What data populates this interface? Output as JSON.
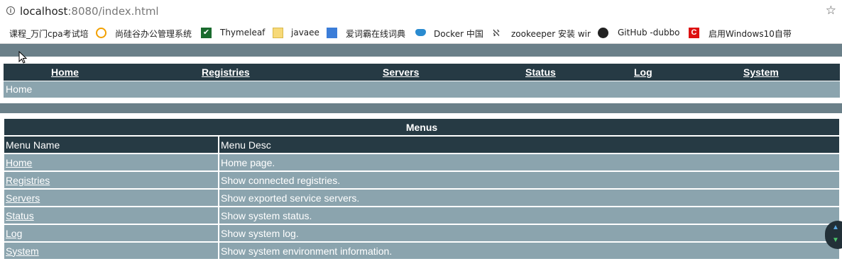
{
  "browser": {
    "url_host": "localhost",
    "url_rest": ":8080/index.html",
    "bookmarks": [
      {
        "label": "课程_万门cpa考试培",
        "icon": "doc-icon"
      },
      {
        "label": "尚硅谷办公管理系统",
        "icon": "u-logo-icon"
      },
      {
        "label": "Thymeleaf",
        "icon": "check-icon"
      },
      {
        "label": "javaee",
        "icon": "folder-icon"
      },
      {
        "label": "爱词霸在线词典",
        "icon": "dictionary-icon"
      },
      {
        "label": "Docker 中国",
        "icon": "docker-icon"
      },
      {
        "label": "zookeeper 安装 wir",
        "icon": "zk-icon"
      },
      {
        "label": "GitHub -dubbo",
        "icon": "github-icon"
      },
      {
        "label": "启用Windows10自带",
        "icon": "c-logo-icon"
      }
    ]
  },
  "nav": {
    "items": [
      "Home",
      "Registries",
      "Servers",
      "Status",
      "Log",
      "System"
    ],
    "breadcrumb": "Home"
  },
  "menus": {
    "title": "Menus",
    "col_name": "Menu Name",
    "col_desc": "Menu Desc",
    "rows": [
      {
        "name": "Home",
        "desc": "Home page."
      },
      {
        "name": "Registries",
        "desc": "Show connected registries."
      },
      {
        "name": "Servers",
        "desc": "Show exported service servers."
      },
      {
        "name": "Status",
        "desc": "Show system status."
      },
      {
        "name": "Log",
        "desc": "Show system log."
      },
      {
        "name": "System",
        "desc": "Show system environment information."
      }
    ]
  },
  "colors": {
    "dark": "#263a44",
    "light": "#8ba4ae",
    "band": "#6b8089"
  }
}
